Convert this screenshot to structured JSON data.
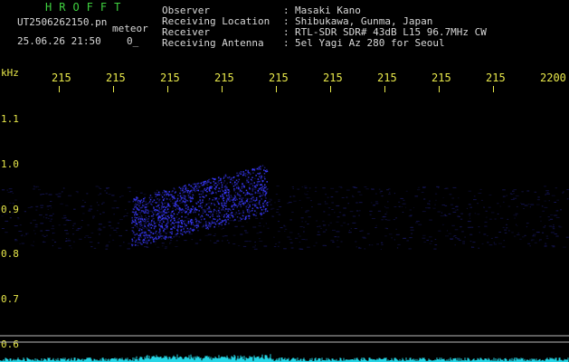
{
  "header": {
    "brand": "HROFFT",
    "file_name": "UT2506262150.pn",
    "meteor_label": "meteor",
    "datetime": "25.06.26 21:50",
    "count": "0_"
  },
  "station": {
    "labels": [
      "Observer",
      "Receiving Location",
      "Receiver",
      "Receiving Antenna"
    ],
    "separator": ":",
    "values": [
      "Masaki Kano",
      "Shibukawa, Gunma, Japan",
      "RTL-SDR SDR# 43dB L15 96.7MHz CW",
      "5el Yagi Az 280 for Seoul"
    ]
  },
  "axes": {
    "y_unit": "kHz",
    "y_ticks": [
      "1.1",
      "1.0",
      "0.9",
      "0.8",
      "0.7",
      "0.6"
    ],
    "x_ticks": [
      "215",
      "215",
      "215",
      "215",
      "215",
      "215",
      "215",
      "215",
      "215",
      "2200"
    ]
  },
  "colors": {
    "background": "#000000",
    "text_yellow": "#e8e84a",
    "text_green": "#3fd13f",
    "echo": "#3a3aff",
    "spectrum": "#25d6e6",
    "hline": "#cfcfcf"
  }
}
